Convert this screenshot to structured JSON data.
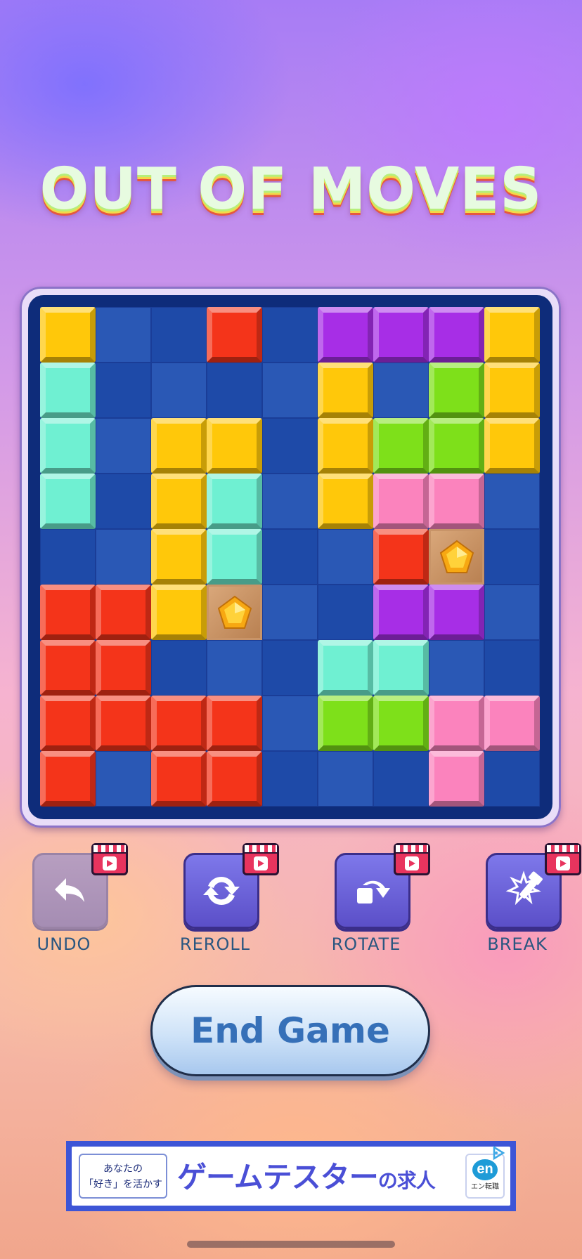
{
  "title": "OUT OF MOVES",
  "board": {
    "rows": 9,
    "cols": 9,
    "colors": {
      "Y": "#ffc80a",
      "R": "#f4341a",
      "P": "#a72ee6",
      "C": "#6ff0d2",
      "G": "#7ee01a",
      "K": "#fb83bd"
    },
    "cells": [
      "Y..R.PPPY",
      "C....Y.GY",
      "C.YY.YGGY",
      "C.YC.YKK.",
      "..YC..R*.",
      "RRY*..PP.",
      "RR...CC..",
      "RRRR.GGKK",
      "R.RR...K."
    ]
  },
  "tools": [
    {
      "label": "UNDO",
      "icon": "undo-arrow-icon",
      "enabled": false
    },
    {
      "label": "REROLL",
      "icon": "reroll-icon",
      "enabled": true
    },
    {
      "label": "ROTATE",
      "icon": "rotate-icon",
      "enabled": true
    },
    {
      "label": "BREAK",
      "icon": "hammer-break-icon",
      "enabled": true
    }
  ],
  "end_button": "End Game",
  "ad": {
    "left_line1": "あなたの",
    "left_line2": "「好き」を活かす",
    "headline": "ゲームテスター",
    "headline_suffix": "の求人",
    "logo_text": "en",
    "logo_caption": "エン転職"
  }
}
